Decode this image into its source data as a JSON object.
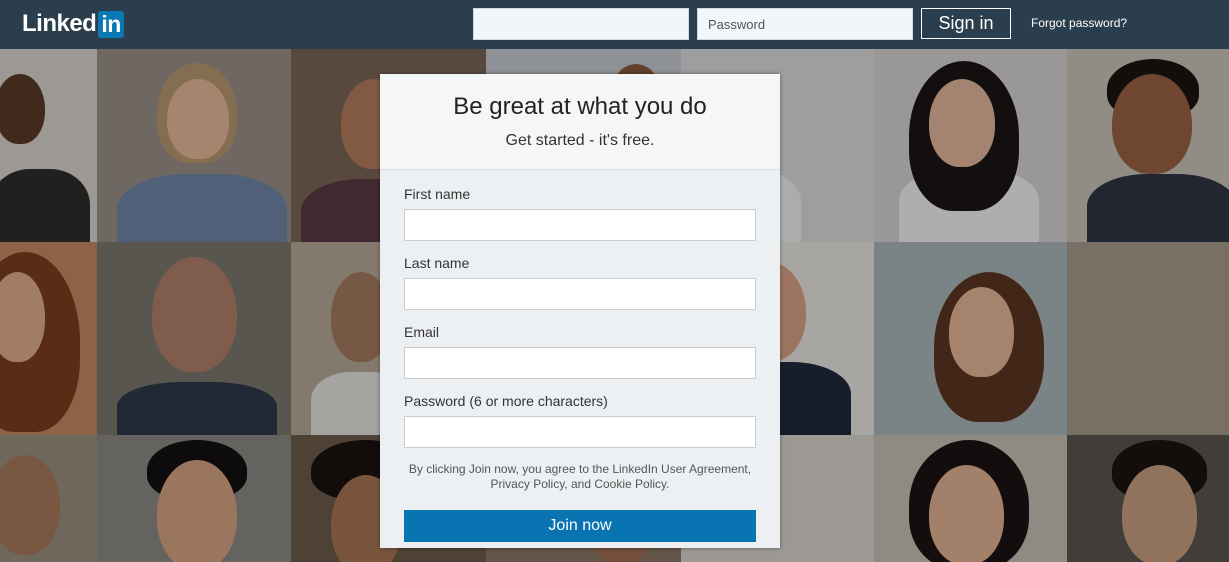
{
  "header": {
    "logo_text": "Linked",
    "logo_badge": "in",
    "email_placeholder": "",
    "password_placeholder": "Password",
    "signin_label": "Sign in",
    "forgot_label": "Forgot password?"
  },
  "signup": {
    "title": "Be great at what you do",
    "subtitle": "Get started - it's free.",
    "fields": [
      {
        "label": "First name"
      },
      {
        "label": "Last name"
      },
      {
        "label": "Email"
      },
      {
        "label": "Password (6 or more characters)"
      }
    ],
    "legal": "By clicking Join now, you agree to the LinkedIn User Agreement, Privacy Policy, and Cookie Policy.",
    "join_label": "Join now"
  },
  "colors": {
    "header_bg": "#2b3e4d",
    "brand_blue": "#0a78b4",
    "join_button": "#0a73b1",
    "panel_bg": "#edf0f3"
  }
}
